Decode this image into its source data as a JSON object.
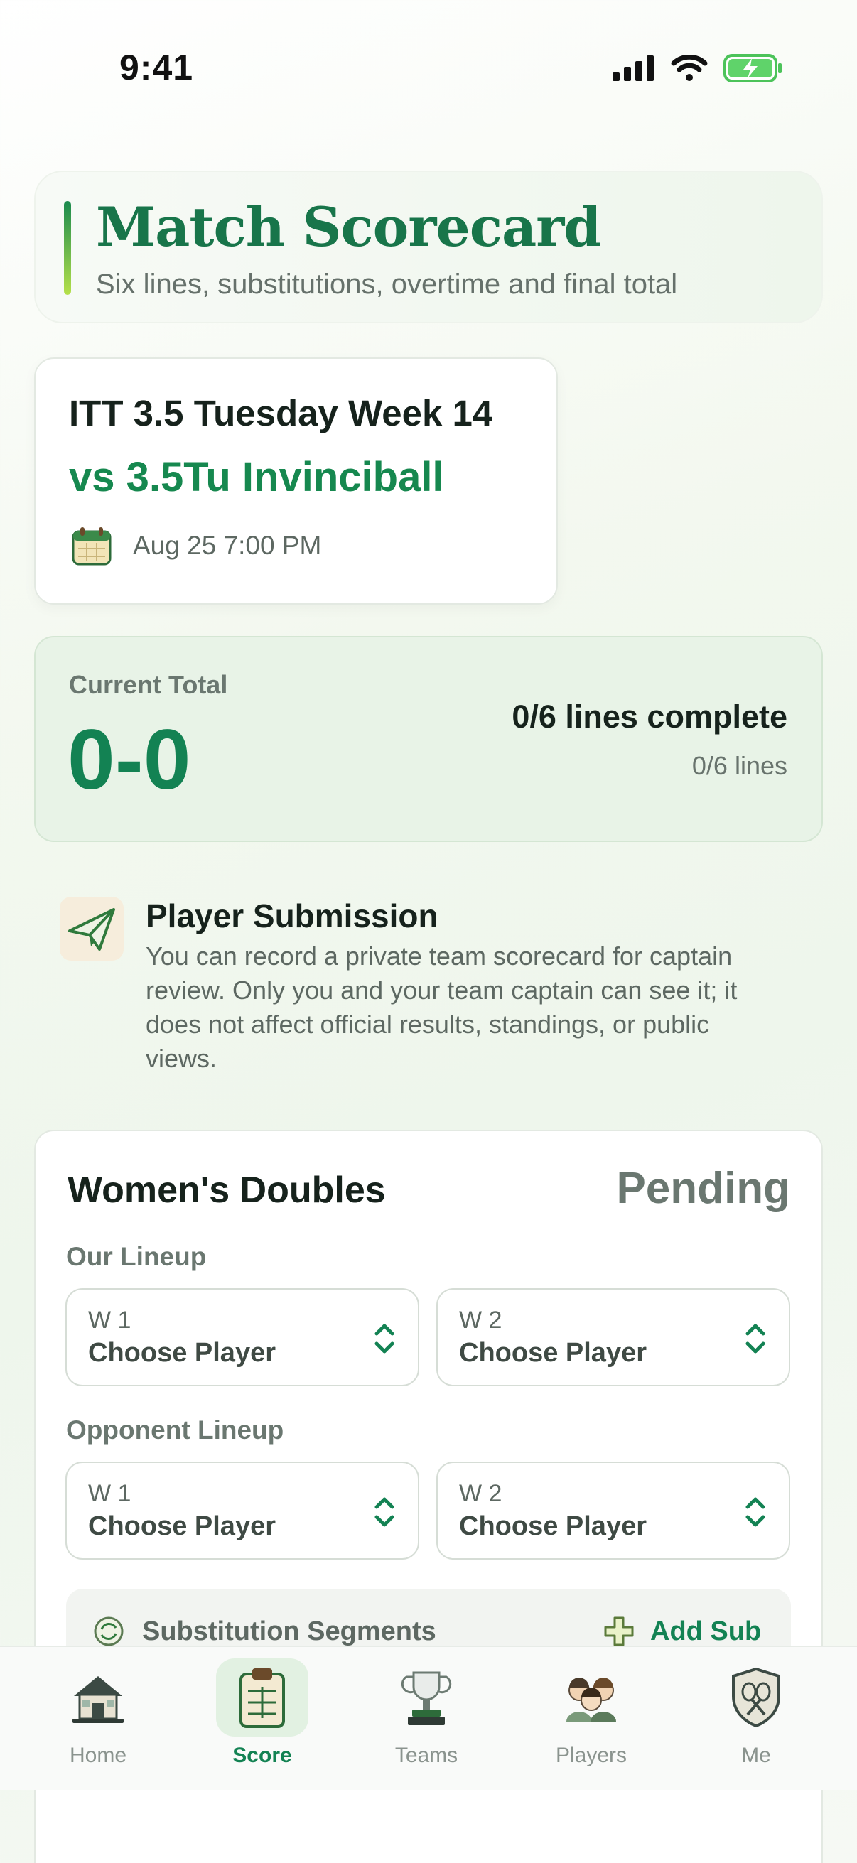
{
  "status_bar": {
    "time": "9:41"
  },
  "header": {
    "title": "Match Scorecard",
    "subtitle": "Six lines, substitutions, overtime and final total"
  },
  "match": {
    "league": "ITT 3.5 Tuesday Week 14",
    "opponent": "vs 3.5Tu Invinciball",
    "datetime": "Aug 25 7:00 PM"
  },
  "total": {
    "label": "Current Total",
    "score": "0-0",
    "lines_complete": "0/6 lines complete",
    "lines_small": "0/6 lines"
  },
  "submission": {
    "title": "Player Submission",
    "body": "You can record a private team scorecard for captain review. Only you and your team captain can see it; it does not affect official results, standings, or public views."
  },
  "line_card": {
    "title": "Women's Doubles",
    "status": "Pending",
    "our_lineup_label": "Our Lineup",
    "opponent_lineup_label": "Opponent Lineup",
    "our_lineup": [
      {
        "slot": "W 1",
        "player": "Choose Player"
      },
      {
        "slot": "W 2",
        "player": "Choose Player"
      }
    ],
    "opponent_lineup": [
      {
        "slot": "W 1",
        "player": "Choose Player"
      },
      {
        "slot": "W 2",
        "player": "Choose Player"
      }
    ],
    "substitution_label": "Substitution Segments",
    "add_sub_label": "Add Sub"
  },
  "tabs": [
    {
      "label": "Home",
      "icon": "house-icon"
    },
    {
      "label": "Score",
      "icon": "clipboard-icon",
      "active": true
    },
    {
      "label": "Teams",
      "icon": "trophy-icon"
    },
    {
      "label": "Players",
      "icon": "players-icon"
    },
    {
      "label": "Me",
      "icon": "shield-icon"
    }
  ],
  "colors": {
    "accent": "#138253",
    "title_green": "#18754a",
    "card_bg": "#ffffff",
    "total_bg": "#e8f3e7"
  }
}
